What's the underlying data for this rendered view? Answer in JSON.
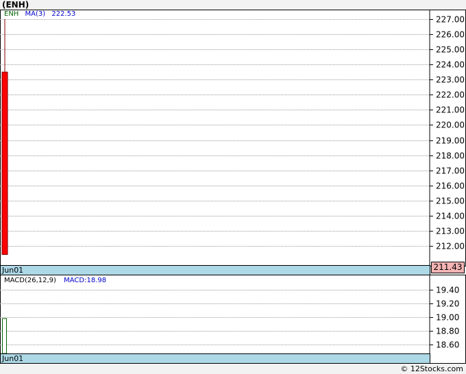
{
  "header": {
    "title": "(ENH)"
  },
  "colors": {
    "down_candle": "#ff0000",
    "wick": "#800000",
    "ma_color": "#0000cc",
    "ticker_color": "#006400",
    "macd_bar": "#006400",
    "date_bar_bg": "#add8e6",
    "price_box_bg": "#f4b4b4",
    "grid": "#999999"
  },
  "legend": {
    "ticker": "ENH",
    "ma_label": "MA(3)",
    "ma_value": "222.53"
  },
  "macd_legend": {
    "params": "MACD(26,12,9)",
    "value_label": "MACD:18.98"
  },
  "price_panel": {
    "date_label": "Jun01",
    "last_price": "211.43"
  },
  "macd_panel": {
    "date_label": "Jun01"
  },
  "footer": {
    "copyright": "© 12Stocks.com"
  },
  "chart_data": [
    {
      "type": "candlestick",
      "ylim": [
        211.0,
        227.5
      ],
      "y_ticks": [
        227.0,
        226.0,
        225.0,
        224.0,
        223.0,
        222.0,
        221.0,
        220.0,
        219.0,
        218.0,
        217.0,
        216.0,
        215.0,
        214.0,
        213.0,
        212.0
      ],
      "y_tick_labels": [
        "227.00",
        "226.00",
        "225.00",
        "224.00",
        "223.00",
        "222.00",
        "221.00",
        "220.00",
        "219.00",
        "218.00",
        "217.00",
        "216.00",
        "215.00",
        "214.00",
        "213.00",
        "212.00"
      ],
      "categories": [
        "Jun01"
      ],
      "candles": [
        {
          "date": "Jun01",
          "open": 223.5,
          "high": 227.0,
          "low": 211.43,
          "close": 211.43
        }
      ],
      "grid": true
    },
    {
      "type": "bar",
      "ylim": [
        18.35,
        19.6
      ],
      "y_ticks": [
        19.4,
        19.2,
        19.0,
        18.8,
        18.6
      ],
      "y_tick_labels": [
        "19.40",
        "19.20",
        "19.00",
        "18.80",
        "18.60"
      ],
      "categories": [
        "Jun01"
      ],
      "values": [
        18.98
      ],
      "grid": true
    }
  ]
}
